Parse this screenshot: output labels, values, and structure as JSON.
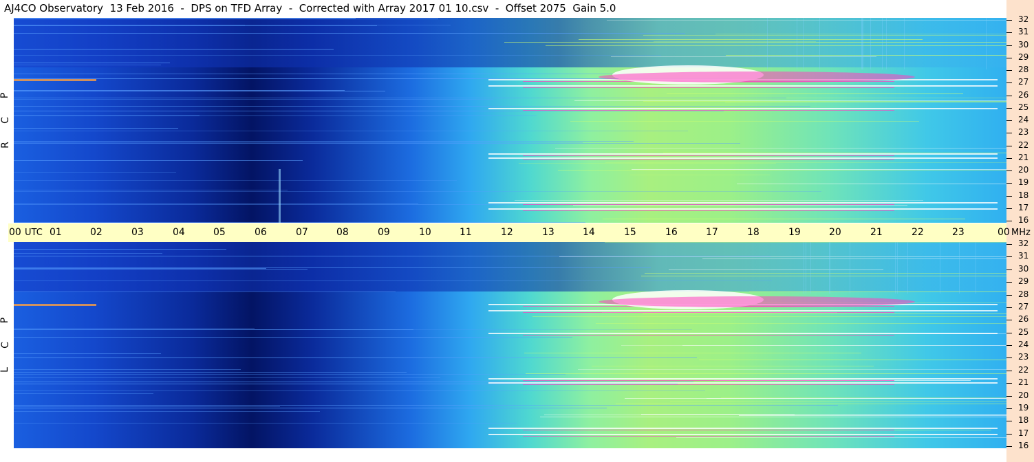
{
  "title": "AJ4CO Observatory  13 Feb 2016  -  DPS on TFD Array  -  Corrected with Array 2017 01 10.csv  -  Offset 2075  Gain 5.0",
  "chart_data": {
    "type": "heatmap",
    "panels": [
      {
        "label": "R C P",
        "letters": [
          "R",
          "C",
          "P"
        ],
        "y_ticks": [
          "32",
          "31",
          "30",
          "29",
          "28",
          "27",
          "26",
          "25",
          "24",
          "23",
          "22",
          "21",
          "20",
          "19",
          "18",
          "17",
          "16"
        ],
        "y_unit": "MHz"
      },
      {
        "label": "L C P",
        "letters": [
          "L",
          "C",
          "P"
        ],
        "y_ticks": [
          "32",
          "31",
          "30",
          "29",
          "28",
          "27",
          "26",
          "25",
          "24",
          "23",
          "22",
          "21",
          "20",
          "19",
          "18",
          "17",
          "16"
        ],
        "y_unit": "MHz"
      }
    ],
    "x_ticks": [
      "00",
      "01",
      "02",
      "03",
      "04",
      "05",
      "06",
      "07",
      "08",
      "09",
      "10",
      "11",
      "12",
      "13",
      "14",
      "15",
      "16",
      "17",
      "18",
      "19",
      "20",
      "21",
      "22",
      "23",
      "00"
    ],
    "x_unit": "UTC",
    "x_range_hours": [
      0,
      24
    ],
    "y_range_mhz": [
      16,
      32
    ],
    "colors": {
      "low": "#00005a",
      "mid": "#1e8cf0",
      "high": "#c8ff60",
      "peak": "#ff40c0",
      "sat": "#ffffff"
    }
  }
}
